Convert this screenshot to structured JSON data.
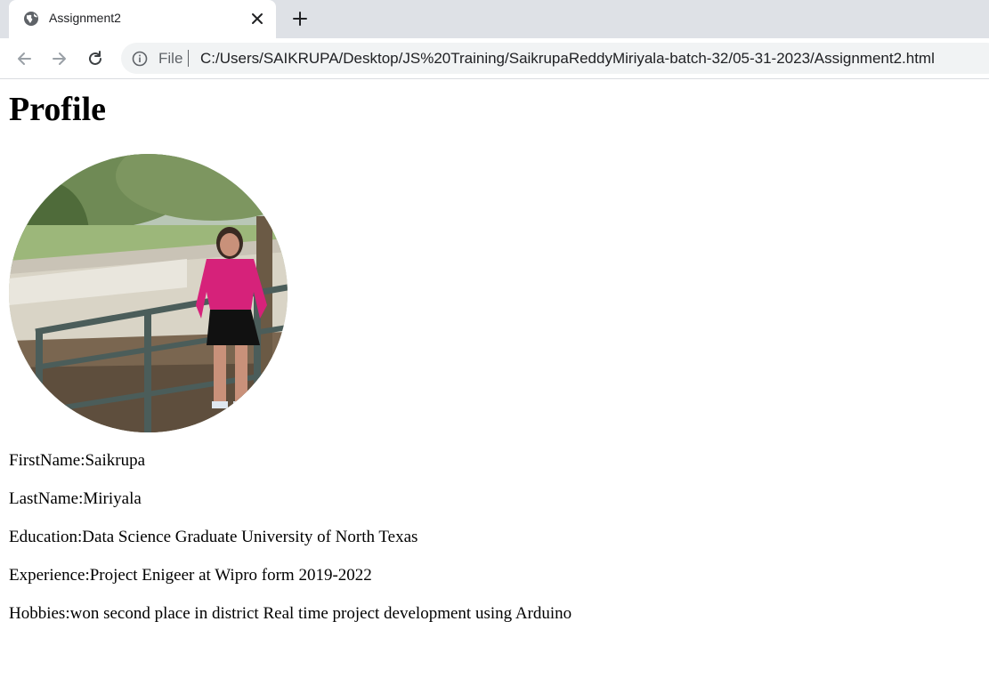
{
  "browser": {
    "tab_title": "Assignment2",
    "scheme_label": "File",
    "url": "C:/Users/SAIKRUPA/Desktop/JS%20Training/SaikrupaReddyMiriyala-batch-32/05-31-2023/Assignment2.html"
  },
  "page": {
    "heading": "Profile",
    "fields": [
      "FirstName:Saikrupa",
      "LastName:Miriyala",
      "Education:Data Science Graduate University of North Texas",
      "Experience:Project Enigeer at Wipro form 2019-2022",
      "Hobbies:won second place in district Real time project development using Arduino"
    ]
  },
  "icons": {
    "favicon": "globe-icon",
    "close": "close-icon",
    "new_tab": "plus-icon",
    "back": "arrow-left-icon",
    "forward": "arrow-right-icon",
    "reload": "reload-icon",
    "info": "info-icon"
  },
  "colors": {
    "tabbar_bg": "#dee1e6",
    "omnibox_bg": "#f1f3f4",
    "text_muted": "#5f6368"
  }
}
